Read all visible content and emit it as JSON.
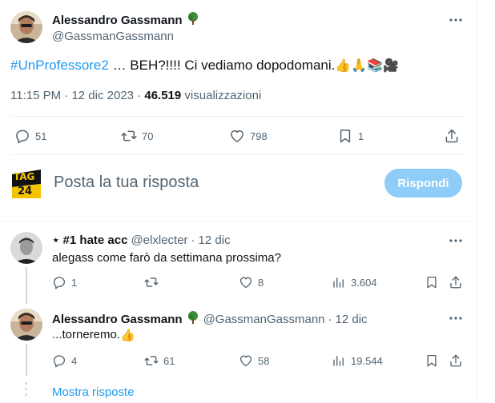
{
  "main_tweet": {
    "author_name": "Alessandro Gassmann",
    "author_badge_icon": "tree-icon",
    "handle": "@GassmanGassmann",
    "hashtag": "#UnProfessore2",
    "text": " … BEH?!!!! Ci vediamo dopodomani.",
    "emojis": "👍🙏📚🎥",
    "time": "11:15 PM",
    "date": "12 dic 2023",
    "views_count": "46.519",
    "views_label": "visualizzazioni",
    "replies": "51",
    "retweets": "70",
    "likes": "798",
    "bookmarks": "1"
  },
  "compose": {
    "avatar_text_top": "TAG",
    "avatar_text_bottom": "24",
    "placeholder": "Posta la tua risposta",
    "button_label": "Rispondi",
    "accent_color": "#1d9bf0",
    "button_color": "#8ecdf8"
  },
  "replies": [
    {
      "author_name": "⋆ #1 hate acc",
      "handle": "@elxlecter",
      "separator": "·",
      "date": "12 dic",
      "text": "alegass come farò da settimana prossima?",
      "replies": "1",
      "retweets": "",
      "likes": "8",
      "views": "3.604"
    },
    {
      "author_name": "Alessandro Gassmann",
      "handle": "@GassmanGassmann",
      "separator": "·",
      "date": "12 dic",
      "text": "...torneremo.",
      "emoji": "👍",
      "replies": "4",
      "retweets": "61",
      "likes": "58",
      "views": "19.544"
    }
  ],
  "show_replies_label": "Mostra risposte"
}
